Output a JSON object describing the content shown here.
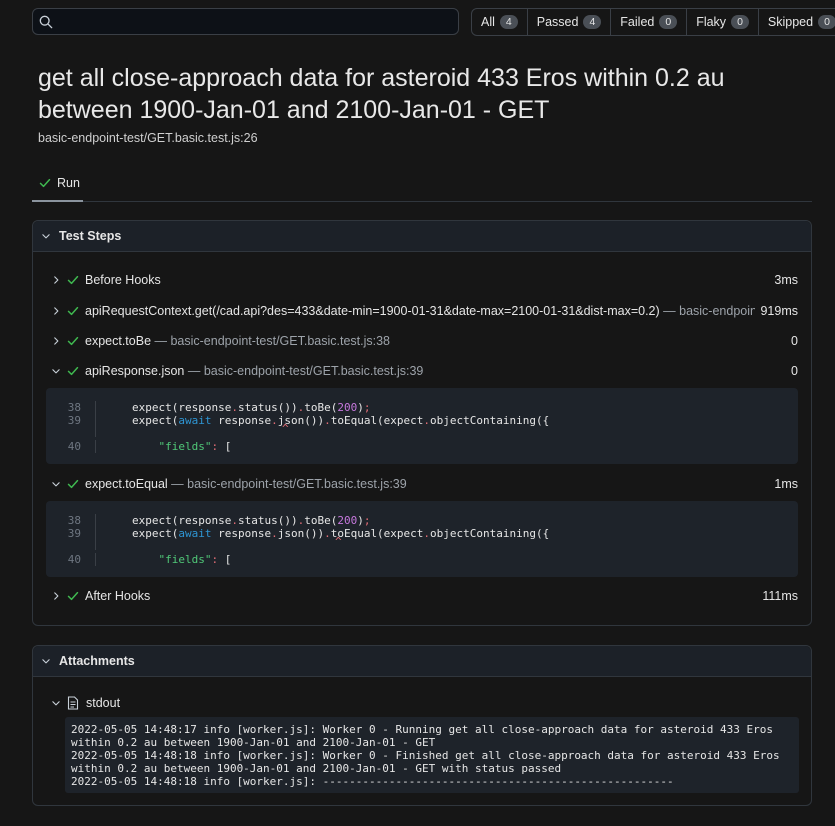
{
  "search": {
    "placeholder": "",
    "value": ""
  },
  "filters": [
    {
      "label": "All",
      "count": "4"
    },
    {
      "label": "Passed",
      "count": "4"
    },
    {
      "label": "Failed",
      "count": "0"
    },
    {
      "label": "Flaky",
      "count": "0"
    },
    {
      "label": "Skipped",
      "count": "0"
    }
  ],
  "test": {
    "title": "get all close-approach data for asteroid 433 Eros within 0.2 au between 1900-Jan-01 and 2100-Jan-01 - GET",
    "location": "basic-endpoint-test/GET.basic.test.js:26"
  },
  "tabs": {
    "run_label": "Run"
  },
  "test_steps": {
    "header": "Test Steps",
    "steps": [
      {
        "name": "Before Hooks",
        "location": "",
        "duration": "3ms"
      },
      {
        "name": "apiRequestContext.get(/cad.api?des=433&date-min=1900-01-31&date-max=2100-01-31&dist-max=0.2)",
        "location": " — basic-endpoint-test/...",
        "duration": "919ms"
      },
      {
        "name": "expect.toBe",
        "location": " — basic-endpoint-test/GET.basic.test.js:38",
        "duration": "0"
      },
      {
        "name": "apiResponse.json",
        "location": " — basic-endpoint-test/GET.basic.test.js:39",
        "duration": "0"
      },
      {
        "name": "expect.toEqual",
        "location": " — basic-endpoint-test/GET.basic.test.js:39",
        "duration": "1ms"
      },
      {
        "name": "After Hooks",
        "location": "",
        "duration": "111ms"
      }
    ],
    "code_lines": [
      "38",
      "39",
      "40"
    ]
  },
  "attachments": {
    "header": "Attachments",
    "stdout_label": "stdout",
    "stdout_text": "2022-05-05 14:48:17 info [worker.js]: Worker 0 - Running get all close-approach data for asteroid 433 Eros\nwithin 0.2 au between 1900-Jan-01 and 2100-Jan-01 - GET\n2022-05-05 14:48:18 info [worker.js]: Worker 0 - Finished get all close-approach data for asteroid 433 Eros\nwithin 0.2 au between 1900-Jan-01 and 2100-Jan-01 - GET with status passed\n2022-05-05 14:48:18 info [worker.js]: -----------------------------------------------------"
  },
  "colors": {
    "passed": "#3fb950",
    "background": "#161616",
    "panel_header": "#1c2128",
    "code_bg": "#1e232a"
  }
}
